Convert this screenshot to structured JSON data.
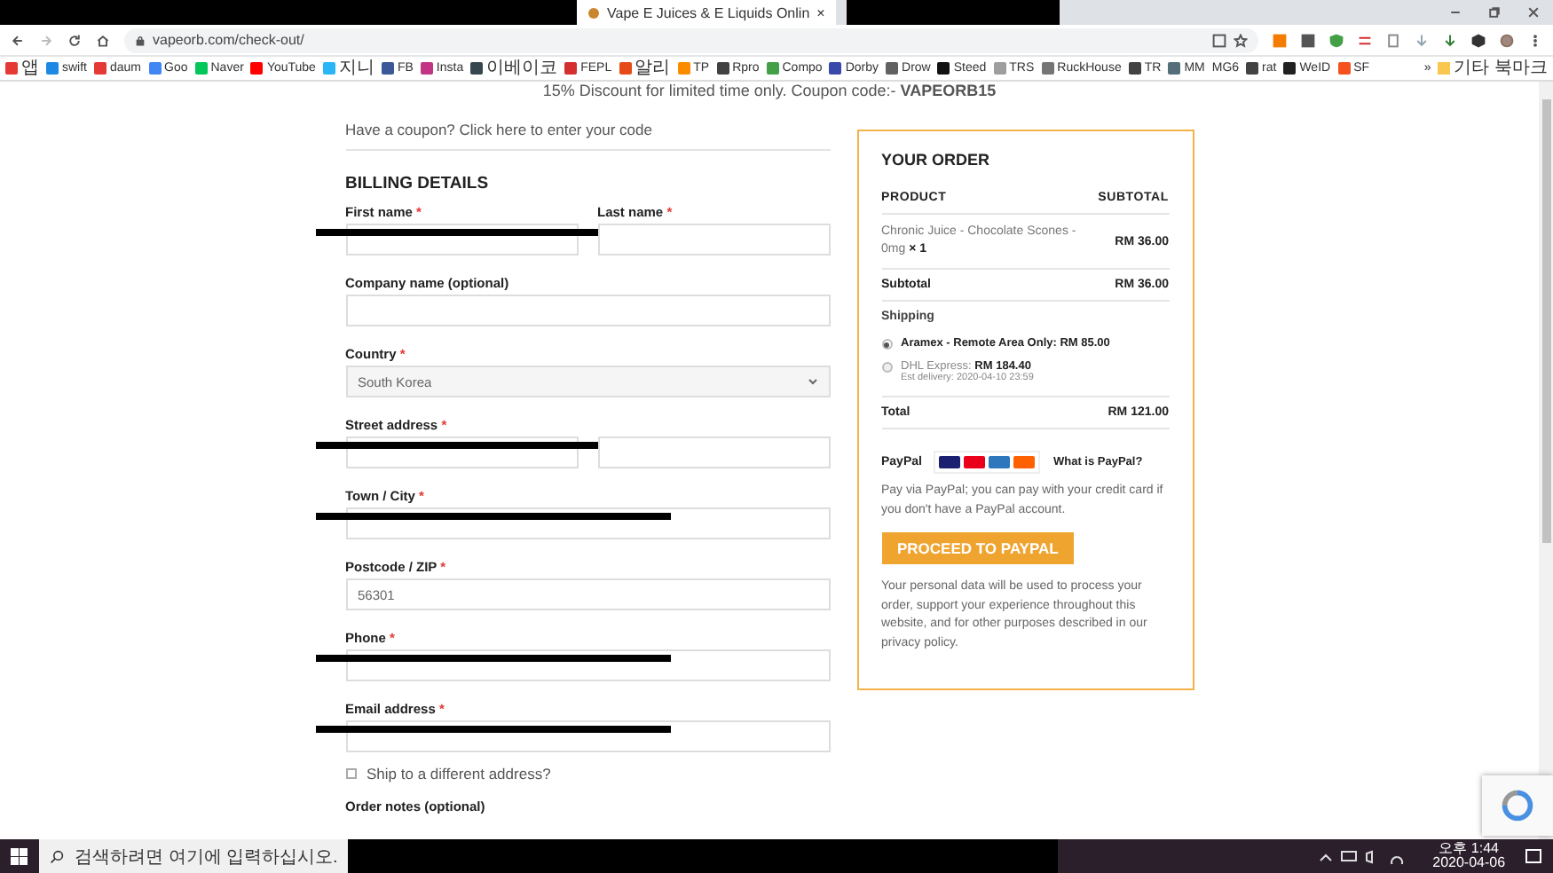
{
  "browser": {
    "tabs": [
      {
        "title": "Vape E Juices & E Liquids Onlin",
        "close": "×",
        "selected": true
      }
    ],
    "url": "vapeorb.com/check-out/",
    "bookmarks": [
      {
        "label": "앱",
        "kind": "hangul",
        "color": "#e53935"
      },
      {
        "label": "swift",
        "kind": "latin",
        "color": "#1e88e5"
      },
      {
        "label": "daum",
        "kind": "latin",
        "color": "#e53935"
      },
      {
        "label": "Goo",
        "kind": "latin",
        "color": "#4285f4"
      },
      {
        "label": "Naver",
        "kind": "latin",
        "color": "#03c75a"
      },
      {
        "label": "YouTube",
        "kind": "latin",
        "color": "#ff0000"
      },
      {
        "label": "지니",
        "kind": "hangul",
        "color": "#29b6f6"
      },
      {
        "label": "FB",
        "kind": "latin",
        "color": "#3b5998"
      },
      {
        "label": "Insta",
        "kind": "latin",
        "color": "#c13584"
      },
      {
        "label": "이베이코",
        "kind": "hangul",
        "color": "#37474f"
      },
      {
        "label": "FEPL",
        "kind": "latin",
        "color": "#d32f2f"
      },
      {
        "label": "알리",
        "kind": "hangul",
        "color": "#e64a19"
      },
      {
        "label": "TP",
        "kind": "latin",
        "color": "#fb8c00"
      },
      {
        "label": "Rpro",
        "kind": "latin",
        "color": "#424242"
      },
      {
        "label": "Compo",
        "kind": "latin",
        "color": "#43a047"
      },
      {
        "label": "Dorby",
        "kind": "latin",
        "color": "#3949ab"
      },
      {
        "label": "Drow",
        "kind": "latin",
        "color": "#616161"
      },
      {
        "label": "Steed",
        "kind": "latin",
        "color": "#111111"
      },
      {
        "label": "TRS",
        "kind": "latin",
        "color": "#9e9e9e"
      },
      {
        "label": "RuckHouse",
        "kind": "latin",
        "color": "#757575"
      },
      {
        "label": "TR",
        "kind": "latin",
        "color": "#424242"
      },
      {
        "label": "MM",
        "kind": "latin",
        "color": "#546e7a"
      },
      {
        "label": "MG6",
        "kind": "latin"
      },
      {
        "label": "rat",
        "kind": "latin",
        "color": "#424242"
      },
      {
        "label": "WeID",
        "kind": "latin",
        "color": "#212121"
      },
      {
        "label": "SF",
        "kind": "latin",
        "color": "#f4511e"
      }
    ],
    "more_bookmarks": "»",
    "other_bookmarks": "기타 북마크"
  },
  "page": {
    "banner": "15% Discount for limited time only. Coupon code:- ",
    "banner_code": "VAPEORB15",
    "coupon": {
      "text": "Have a coupon? ",
      "link": "Click here to enter your code"
    },
    "billing": {
      "title": "BILLING DETAILS",
      "rows": [
        {
          "fields": [
            {
              "label": "First name",
              "required_mark": "*",
              "kind": "text",
              "redacted": true
            },
            {
              "label": "Last name",
              "required_mark": "*",
              "kind": "text"
            }
          ]
        },
        {
          "fields": [
            {
              "label": "Company name (optional)",
              "kind": "text"
            }
          ]
        },
        {
          "fields": [
            {
              "label": "Country",
              "required_mark": "*",
              "value": "South Korea",
              "kind": "select"
            }
          ]
        },
        {
          "fields": [
            {
              "label": "Street address",
              "required_mark": "*",
              "kind": "text",
              "redacted": true
            },
            {
              "kind": "text"
            }
          ]
        },
        {
          "fields": [
            {
              "label": "Town / City",
              "required_mark": "*",
              "kind": "text",
              "redacted": true
            }
          ]
        },
        {
          "fields": [
            {
              "label": "Postcode / ZIP",
              "required_mark": "*",
              "kind": "text",
              "value": "56301"
            }
          ]
        },
        {
          "fields": [
            {
              "label": "Phone",
              "required_mark": "*",
              "kind": "text",
              "redacted": true
            }
          ]
        },
        {
          "fields": [
            {
              "label": "Email address",
              "required_mark": "*",
              "kind": "text",
              "redacted": true
            }
          ]
        }
      ],
      "ship_different": {
        "label": "Ship to a different address?",
        "checked": false
      },
      "order_notes": "Order notes (optional)"
    },
    "order": {
      "title": "YOUR ORDER",
      "columns": [
        "PRODUCT",
        "SUBTOTAL"
      ],
      "items": [
        {
          "name": "Chronic Juice - Chocolate Scones - 0mg",
          "qty": "× 1",
          "price": "RM 36.00"
        }
      ],
      "subtotal": {
        "label": "Subtotal",
        "value": "RM 36.00"
      },
      "shipping": {
        "label": "Shipping",
        "options": [
          {
            "name": "Aramex - Remote Area Only:",
            "price": "RM 85.00",
            "selected": true
          },
          {
            "name": "DHL Express:",
            "price": "RM 184.40",
            "note": "Est delivery: 2020-04-10 23:59",
            "selected": false
          }
        ]
      },
      "total": {
        "label": "Total",
        "value": "RM 121.00"
      },
      "payment": {
        "name": "PayPal",
        "what": "What is PayPal?",
        "description": "Pay via PayPal; you can pay with your credit card if you don't have a PayPal account."
      },
      "button": "PROCEED TO PAYPAL",
      "privacy": "Your personal data will be used to process your order, support your experience throughout this website, and for other purposes described in our privacy policy."
    }
  },
  "taskbar": {
    "search_placeholder": "검색하려면 여기에 입력하십시오.",
    "time": "오후 1:44",
    "date": "2020-04-06"
  }
}
